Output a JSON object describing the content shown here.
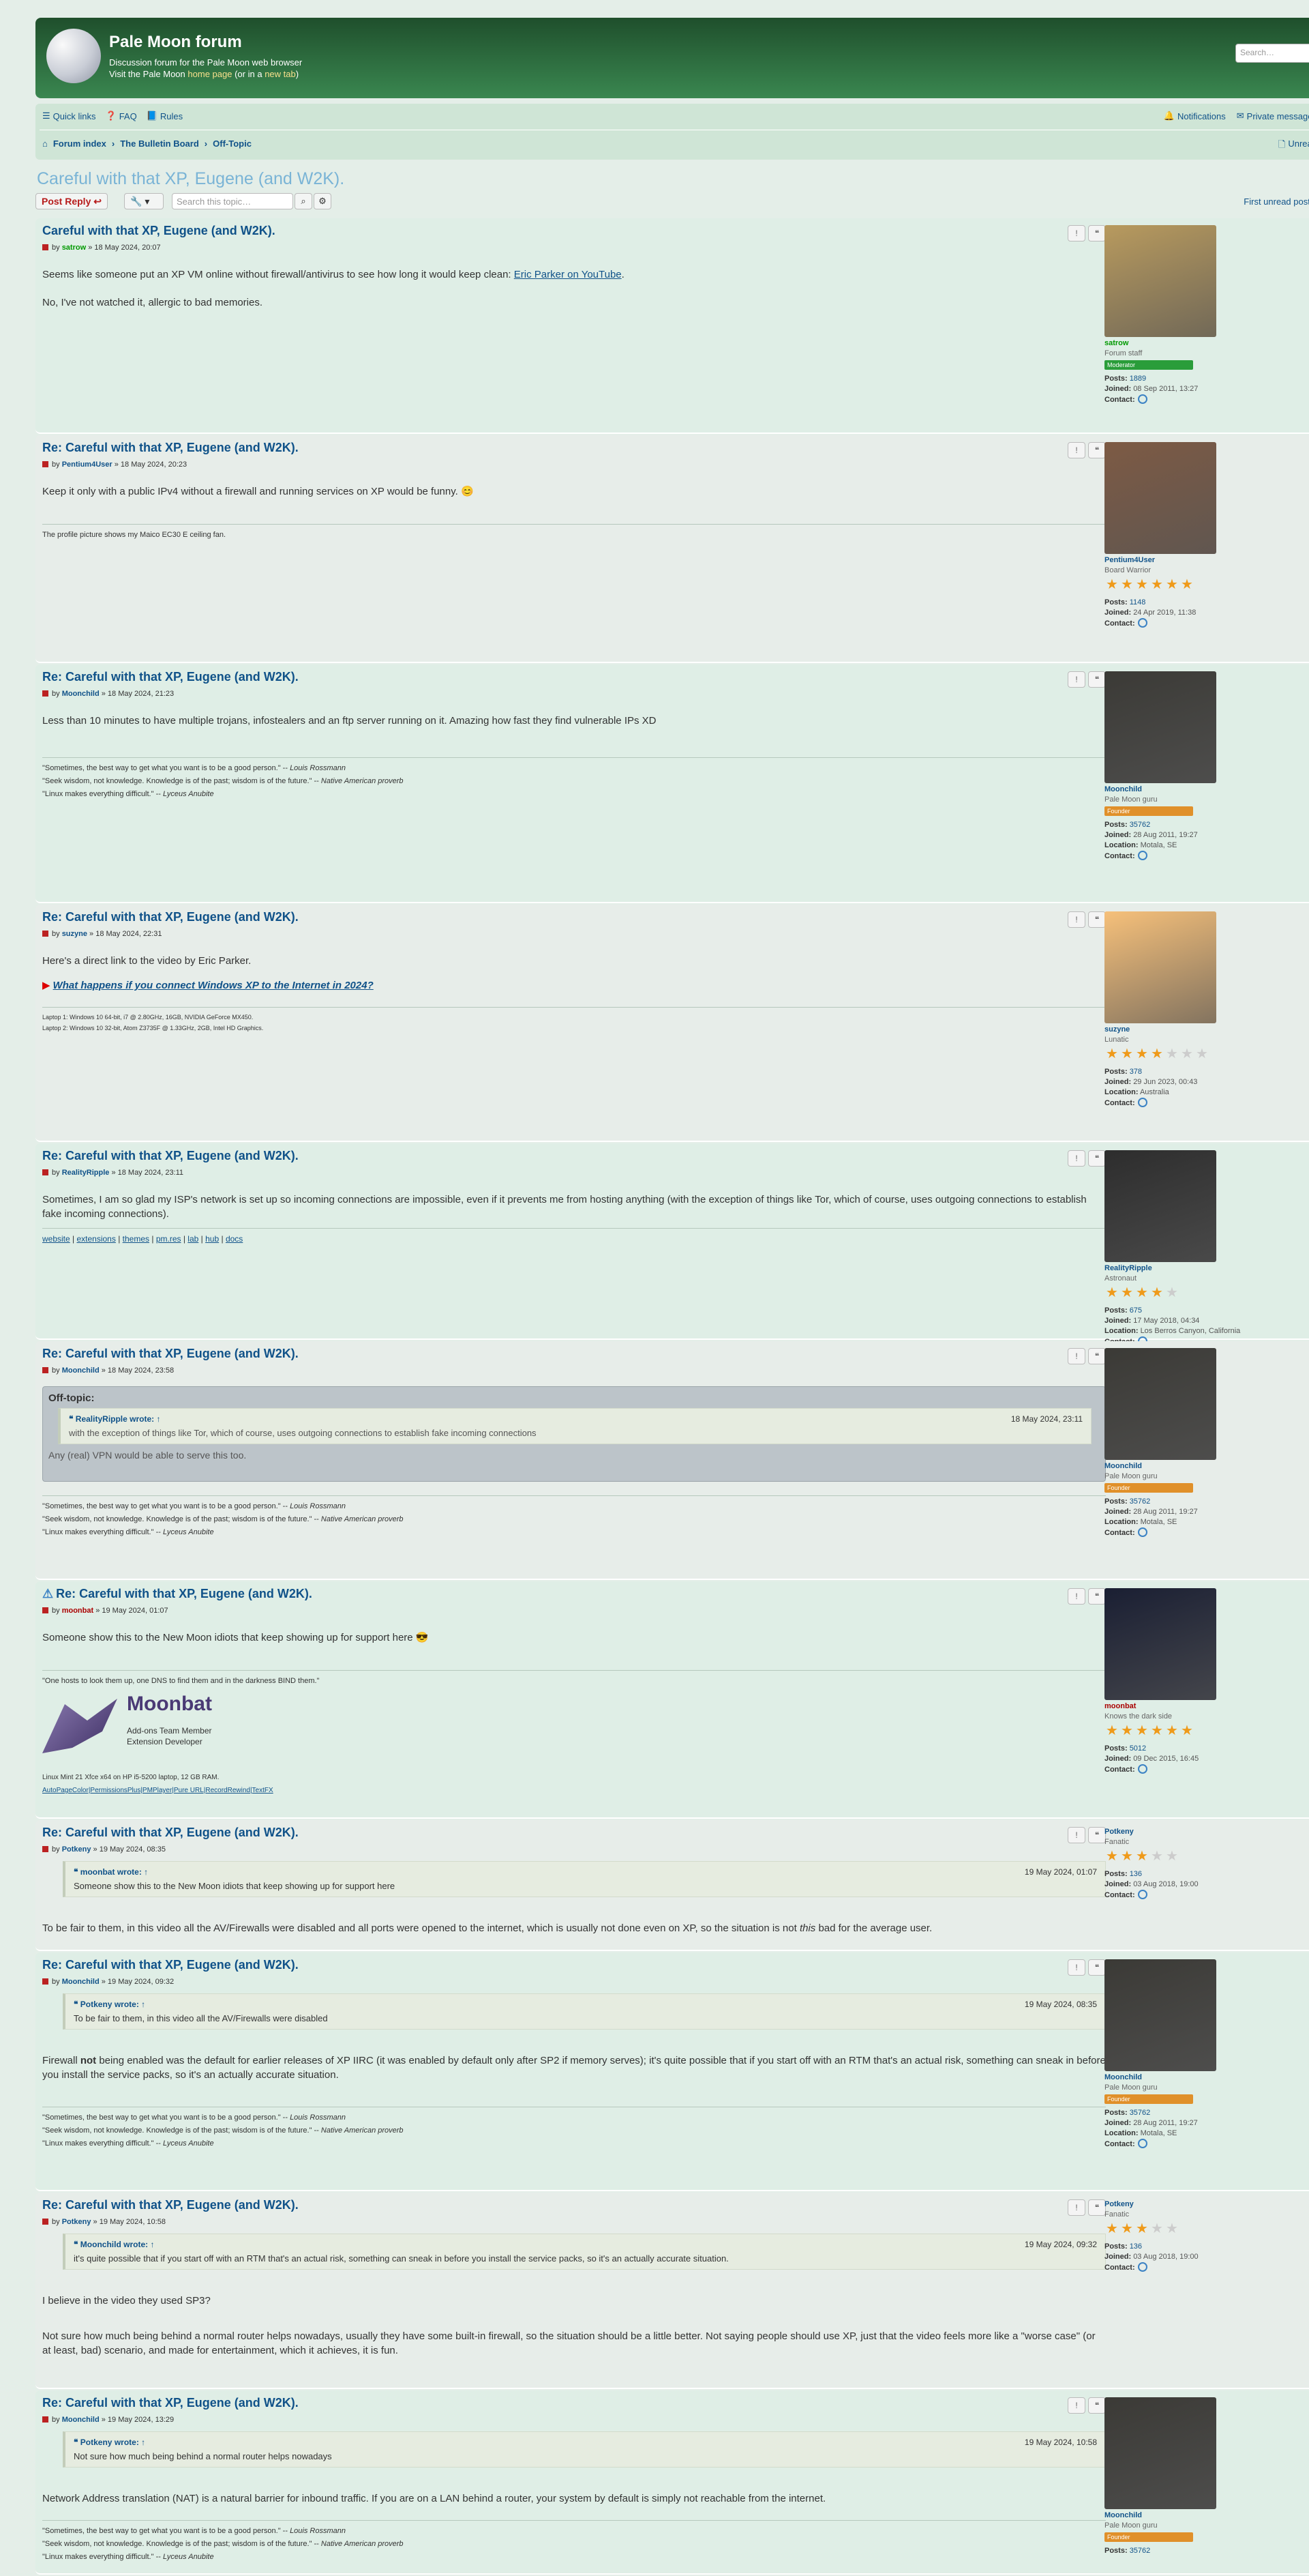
{
  "header": {
    "title": "Pale Moon forum",
    "desc": "Discussion forum for the Pale Moon web browser",
    "desc2_a": "Visit the Pale Moon",
    "desc2_b": "home page",
    "desc2_c": "(or in a",
    "desc2_d": "new tab",
    "desc2_e": ")",
    "search_placeholder": "Search…"
  },
  "nav": {
    "quick_links": "Quick links",
    "faq": "FAQ",
    "rules": "Rules",
    "notifications": "Notifications",
    "private_messages": "Private messages",
    "breadcrumb": [
      "Forum index",
      "The Bulletin Board",
      "Off-Topic"
    ],
    "unread": "Unread"
  },
  "topic": {
    "title": "Careful with that XP, Eugene (and W2K).",
    "post_reply": "Post Reply",
    "search_placeholder": "Search this topic…",
    "first_unread": "First unread post"
  },
  "posts": [
    {
      "title": "Careful with that XP, Eugene (and W2K).",
      "by": "by",
      "author": "satrow",
      "date": "» 18 May 2024, 20:07",
      "c1a": "Seems like someone put an XP VM online without firewall/antivirus to see how long it would keep clean: ",
      "c1link": "Eric Parker on YouTube",
      "c1b": ".",
      "c2": "No, I've not watched it, allergic to bad memories.",
      "name": "satrow",
      "rank": "Forum staff",
      "badge": "Moderator",
      "posts_label": "Posts:",
      "posts": "1889",
      "joined_label": "Joined:",
      "joined": "08 Sep 2011, 13:27",
      "contact": "Contact:"
    },
    {
      "title": "Re: Careful with that XP, Eugene (and W2K).",
      "by": "by",
      "author": "Pentium4User",
      "date": "» 18 May 2024, 20:23",
      "c1": "Keep it only with a public IPv4 without a firewall and running services on XP would be funny.",
      "sig": "The profile picture shows my Maico EC30 E ceiling fan.",
      "name": "Pentium4User",
      "rank": "Board Warrior",
      "posts_label": "Posts:",
      "posts": "1148",
      "joined_label": "Joined:",
      "joined": "24 Apr 2019, 11:38",
      "contact": "Contact:"
    },
    {
      "title": "Re: Careful with that XP, Eugene (and W2K).",
      "by": "by",
      "author": "Moonchild",
      "date": "» 18 May 2024, 21:23",
      "c1": "Less than 10 minutes to have multiple trojans, infostealers and an ftp server running on it. Amazing how fast they find vulnerable IPs XD",
      "sig1a": "\"Sometimes, the best way to get what you want is to be a good person.\" -- ",
      "sig1b": "Louis Rossmann",
      "sig2a": "\"Seek wisdom, not knowledge. Knowledge is of the past; wisdom is of the future.\" -- ",
      "sig2b": "Native American proverb",
      "sig3a": "\"Linux makes everything difficult.\" -- ",
      "sig3b": "Lyceus Anubite",
      "name": "Moonchild",
      "rank": "Pale Moon guru",
      "badge": "Founder",
      "posts_label": "Posts:",
      "posts": "35762",
      "joined_label": "Joined:",
      "joined": "28 Aug 2011, 19:27",
      "location_label": "Location:",
      "location": "Motala, SE",
      "contact": "Contact:"
    },
    {
      "title": "Re: Careful with that XP, Eugene (and W2K).",
      "by": "by",
      "author": "suzyne",
      "date": "» 18 May 2024, 22:31",
      "c1": "Here's a direct link to the video by Eric Parker.",
      "c2": "What happens if you connect Windows XP to the Internet in 2024?",
      "sig1": "Laptop 1: Windows 10 64-bit, i7 @ 2.80GHz, 16GB, NVIDIA GeForce MX450.",
      "sig2": "Laptop 2: Windows 10 32-bit, Atom Z3735F @ 1.33GHz, 2GB, Intel HD Graphics.",
      "name": "suzyne",
      "rank": "Lunatic",
      "posts_label": "Posts:",
      "posts": "378",
      "joined_label": "Joined:",
      "joined": "29 Jun 2023, 00:43",
      "location_label": "Location:",
      "location": "Australia",
      "contact": "Contact:"
    },
    {
      "title": "Re: Careful with that XP, Eugene (and W2K).",
      "by": "by",
      "author": "RealityRipple",
      "date": "» 18 May 2024, 23:11",
      "c1": "Sometimes, I am so glad my ISP's network is set up so incoming connections are impossible, even if it prevents me from hosting anything (with the exception of things like Tor, which of course, uses outgoing connections to establish fake incoming connections).",
      "sig_links": [
        "website",
        "extensions",
        "themes",
        "pm.res",
        "lab",
        "hub",
        "docs"
      ],
      "name": "RealityRipple",
      "rank": "Astronaut",
      "posts_label": "Posts:",
      "posts": "675",
      "joined_label": "Joined:",
      "joined": "17 May 2018, 04:34",
      "location_label": "Location:",
      "location": "Los Berros Canyon, California",
      "contact": "Contact:"
    },
    {
      "title": "Re: Careful with that XP, Eugene (and W2K).",
      "by": "by",
      "author": "Moonchild",
      "date": "» 18 May 2024, 23:58",
      "offtopic": "Off-topic:",
      "q_author": "RealityRipple",
      "q_wrote": "wrote: ↑",
      "q_date": "18 May 2024, 23:11",
      "q_text": "with the exception of things like Tor, which of course, uses outgoing connections to establish fake incoming connections",
      "c1": "Any (real) VPN would be able to serve this too.",
      "sig1a": "\"Sometimes, the best way to get what you want is to be a good person.\" -- ",
      "sig1b": "Louis Rossmann",
      "sig2a": "\"Seek wisdom, not knowledge. Knowledge is of the past; wisdom is of the future.\" -- ",
      "sig2b": "Native American proverb",
      "sig3a": "\"Linux makes everything difficult.\" -- ",
      "sig3b": "Lyceus Anubite",
      "name": "Moonchild",
      "rank": "Pale Moon guru",
      "badge": "Founder",
      "posts_label": "Posts:",
      "posts": "35762",
      "joined_label": "Joined:",
      "joined": "28 Aug 2011, 19:27",
      "location_label": "Location:",
      "location": "Motala, SE",
      "contact": "Contact:"
    },
    {
      "title": "Re: Careful with that XP, Eugene (and W2K).",
      "by": "by",
      "author": "moonbat",
      "date": "» 19 May 2024, 01:07",
      "c1": "Someone show this to the New Moon idiots that keep showing up for support here",
      "sig1": "\"One hosts to look them up, one DNS to find them and in the darkness BIND them.\"",
      "logo_title": "Moonbat",
      "logo_l1": "Add-ons Team Member",
      "logo_l2": "Extension Developer",
      "sig2": "Linux Mint 21 Xfce x64 on HP i5-5200 laptop, 12 GB RAM.",
      "sig3": "AutoPageColor|PermissionsPlus|PMPlayer|Pure URL|RecordRewind|TextFX",
      "name": "moonbat",
      "rank": "Knows the dark side",
      "posts_label": "Posts:",
      "posts": "5012",
      "joined_label": "Joined:",
      "joined": "09 Dec 2015, 16:45",
      "contact": "Contact:"
    },
    {
      "title": "Re: Careful with that XP, Eugene (and W2K).",
      "by": "by",
      "author": "Potkeny",
      "date": "» 19 May 2024, 08:35",
      "q_author": "moonbat",
      "q_wrote": "wrote: ↑",
      "q_date": "19 May 2024, 01:07",
      "q_text": "Someone show this to the New Moon idiots that keep showing up for support here",
      "c1a": "To be fair to them, in this video all the AV/Firewalls were disabled and all ports were opened to the internet, which is usually not done even on XP, so the situation is not ",
      "c1i": "this",
      "c1b": " bad for the average user.",
      "name": "Potkeny",
      "rank": "Fanatic",
      "posts_label": "Posts:",
      "posts": "136",
      "joined_label": "Joined:",
      "joined": "03 Aug 2018, 19:00",
      "contact": "Contact:"
    },
    {
      "title": "Re: Careful with that XP, Eugene (and W2K).",
      "by": "by",
      "author": "Moonchild",
      "date": "» 19 May 2024, 09:32",
      "q_author": "Potkeny",
      "q_wrote": "wrote: ↑",
      "q_date": "19 May 2024, 08:35",
      "q_text": "To be fair to them, in this video all the AV/Firewalls were disabled",
      "c1a": "Firewall ",
      "c1b": "not",
      "c1c": " being enabled was the default for earlier releases of XP IIRC (it was enabled by default only after SP2 if memory serves); it's quite possible that if you start off with an RTM that's an actual risk, something can sneak in before you install the service packs, so it's an actually accurate situation.",
      "sig1a": "\"Sometimes, the best way to get what you want is to be a good person.\" -- ",
      "sig1b": "Louis Rossmann",
      "sig2a": "\"Seek wisdom, not knowledge. Knowledge is of the past; wisdom is of the future.\" -- ",
      "sig2b": "Native American proverb",
      "sig3a": "\"Linux makes everything difficult.\" -- ",
      "sig3b": "Lyceus Anubite",
      "name": "Moonchild",
      "rank": "Pale Moon guru",
      "badge": "Founder",
      "posts_label": "Posts:",
      "posts": "35762",
      "joined_label": "Joined:",
      "joined": "28 Aug 2011, 19:27",
      "location_label": "Location:",
      "location": "Motala, SE",
      "contact": "Contact:"
    },
    {
      "title": "Re: Careful with that XP, Eugene (and W2K).",
      "by": "by",
      "author": "Potkeny",
      "date": "» 19 May 2024, 10:58",
      "q_author": "Moonchild",
      "q_wrote": "wrote: ↑",
      "q_date": "19 May 2024, 09:32",
      "q_text": "it's quite possible that if you start off with an RTM that's an actual risk, something can sneak in before you install the service packs, so it's an actually accurate situation.",
      "c1": "I believe in the video they used SP3?",
      "c2": "Not sure how much being behind a normal router helps nowadays, usually they have some built-in firewall, so the situation should be a little better. Not saying people should use XP, just that the video feels more like a \"worse case\" (or at least, bad) scenario, and made for entertainment, which it achieves, it is fun.",
      "name": "Potkeny",
      "rank": "Fanatic",
      "posts_label": "Posts:",
      "posts": "136",
      "joined_label": "Joined:",
      "joined": "03 Aug 2018, 19:00",
      "contact": "Contact:"
    },
    {
      "title": "Re: Careful with that XP, Eugene (and W2K).",
      "by": "by",
      "author": "Moonchild",
      "date": "» 19 May 2024, 13:29",
      "q_author": "Potkeny",
      "q_wrote": "wrote: ↑",
      "q_date": "19 May 2024, 10:58",
      "q_text": "Not sure how much being behind a normal router helps nowadays",
      "c1": "Network Address translation (NAT) is a natural barrier for inbound traffic. If you are on a LAN behind a router, your system by default is simply not reachable from the internet.",
      "sig1a": "\"Sometimes, the best way to get what you want is to be a good person.\" -- ",
      "sig1b": "Louis Rossmann",
      "sig2a": "\"Seek wisdom, not knowledge. Knowledge is of the past; wisdom is of the future.\" -- ",
      "sig2b": "Native American proverb",
      "sig3a": "\"Linux makes everything difficult.\" -- ",
      "sig3b": "Lyceus Anubite",
      "name": "Moonchild",
      "rank": "Pale Moon guru",
      "badge": "Founder",
      "posts_label": "Posts:",
      "posts": "35762"
    }
  ],
  "icons": {
    "report": "report-icon",
    "quote": "quote-icon",
    "post": "post-icon",
    "contact": "contact-icon",
    "star": "star-icon"
  },
  "colors": {
    "header": "#2d6a3e",
    "nav": "#cfe5d6",
    "link": "#105289",
    "staff": "#009900",
    "moderator_badge": "#2a9d3a",
    "founder_badge": "#e0902a",
    "star": "#ef9a1a"
  }
}
